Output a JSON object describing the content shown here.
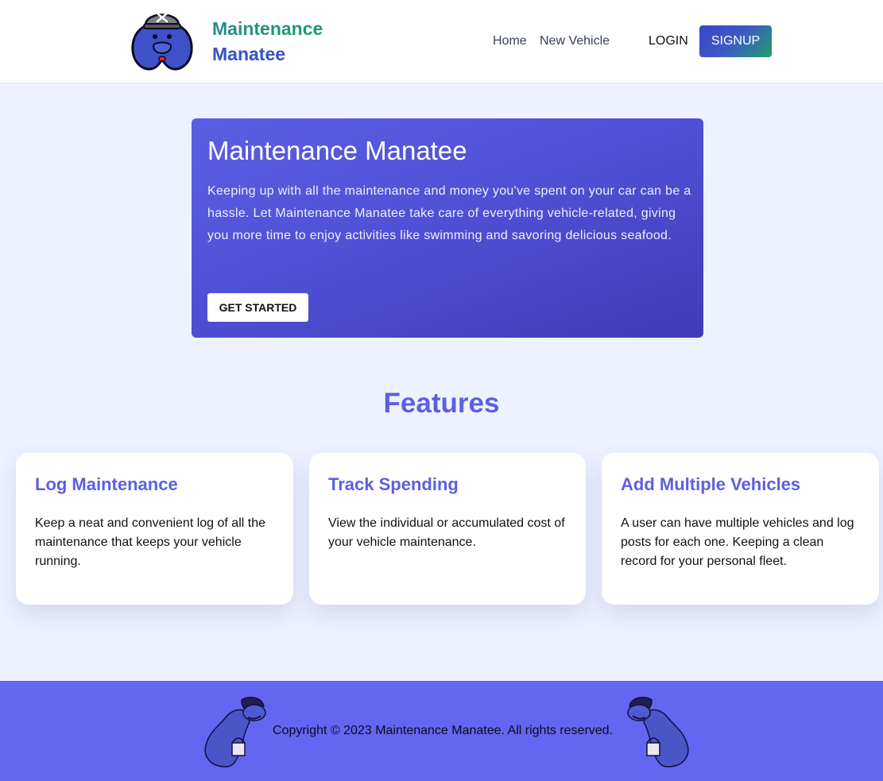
{
  "header": {
    "brand_line1": "Maintenance",
    "brand_line2": "Manatee",
    "nav": {
      "home": "Home",
      "new_vehicle": "New Vehicle"
    },
    "login": "LOGIN",
    "signup": "SIGNUP"
  },
  "hero": {
    "title": "Maintenance Manatee",
    "text": "Keeping up with all the maintenance and money you've spent on your car can be a hassle. Let Maintenance Manatee take care of everything vehicle-related, giving you more time to enjoy activities like swimming and savoring delicious seafood.",
    "button": "GET STARTED"
  },
  "features": {
    "title": "Features",
    "cards": [
      {
        "title": "Log Maintenance",
        "text": "Keep a neat and convenient log of all the maintenance that keeps your vehicle running."
      },
      {
        "title": "Track Spending",
        "text": "View the individual or accumulated cost of your vehicle maintenance."
      },
      {
        "title": "Add Multiple Vehicles",
        "text": "A user can have multiple vehicles and log posts for each one. Keeping a clean record for your personal fleet."
      }
    ]
  },
  "footer": {
    "copyright": "Copyright © 2023 Maintenance Manatee. All rights reserved."
  },
  "colors": {
    "accent": "#5b5fe2",
    "footer_bg": "#6366f1",
    "page_bg": "#eef2ff"
  }
}
